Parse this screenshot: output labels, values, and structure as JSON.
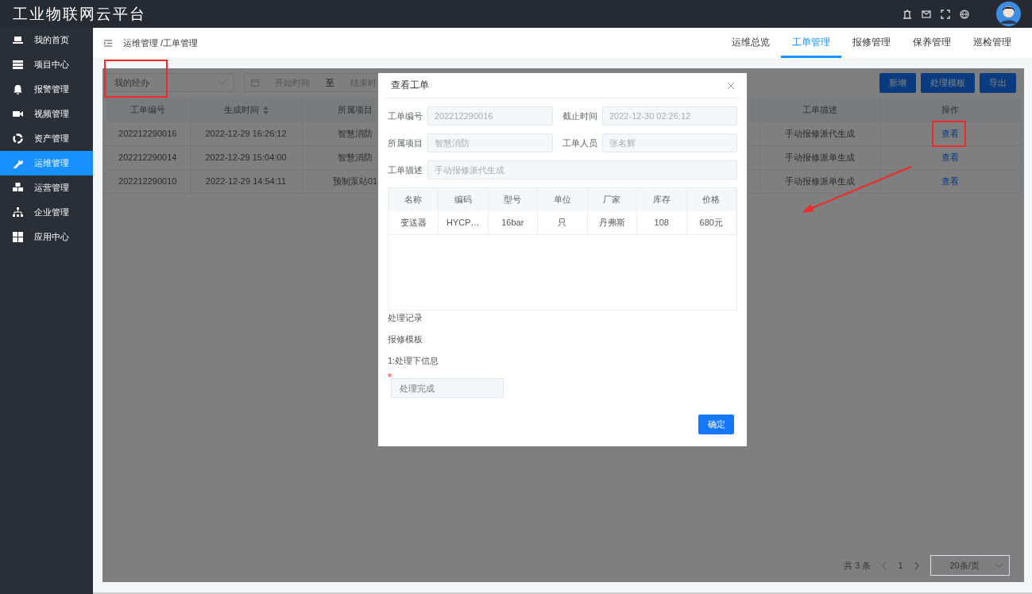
{
  "app": {
    "title": "工业物联网云平台"
  },
  "sidebar": {
    "items": [
      {
        "label": "我的首页",
        "selected": false
      },
      {
        "label": "项目中心",
        "selected": false
      },
      {
        "label": "报警管理",
        "selected": false
      },
      {
        "label": "视频管理",
        "selected": false
      },
      {
        "label": "资产管理",
        "selected": false
      },
      {
        "label": "运维管理",
        "selected": true
      },
      {
        "label": "运营管理",
        "selected": false
      },
      {
        "label": "企业管理",
        "selected": false
      },
      {
        "label": "应用中心",
        "selected": false
      }
    ]
  },
  "breadcrumb": "运维管理 /工单管理",
  "tabs": [
    {
      "label": "运维总览",
      "selected": false
    },
    {
      "label": "工单管理",
      "selected": true
    },
    {
      "label": "报修管理",
      "selected": false
    },
    {
      "label": "保养管理",
      "selected": false
    },
    {
      "label": "巡检管理",
      "selected": false
    }
  ],
  "filters": {
    "scope": {
      "value": "我的经办"
    },
    "date_range": {
      "start_placeholder": "开始时间",
      "separator": "至",
      "end_placeholder": "结束时"
    }
  },
  "actions": [
    "新增",
    "处理模板",
    "导出"
  ],
  "table": {
    "columns": [
      {
        "label": "工单编号",
        "sortable": false
      },
      {
        "label": "生成时间",
        "sortable": true
      },
      {
        "label": "所属项目",
        "sortable": false
      },
      {
        "label": "工单描述",
        "sortable": false
      },
      {
        "label": "操作",
        "sortable": false
      }
    ],
    "rows": [
      {
        "cells": [
          "202212290016",
          "2022-12-29 16:26:12",
          "智慧消防",
          "手动报修派代生成"
        ],
        "action": "查看"
      },
      {
        "cells": [
          "202212290014",
          "2022-12-29 15:04:00",
          "智慧消防",
          "手动报修派单生成"
        ],
        "action": "查看"
      },
      {
        "cells": [
          "202212290010",
          "2022-12-29 14:54:11",
          "预制泵站01",
          "手动报修派单生成"
        ],
        "action": "查看"
      }
    ]
  },
  "pagination": {
    "total": "共 3 条",
    "page": "1",
    "page_size": "20条/页"
  },
  "dialog": {
    "title": "查看工单",
    "fields": [
      {
        "label": "工单编号",
        "value": "202212290016"
      },
      {
        "label": "截止时间",
        "value": "2022-12-30 02:26:12"
      },
      {
        "label": "所属项目",
        "value": "智慧消防"
      },
      {
        "label": "工单人员",
        "value": "张名辉"
      }
    ],
    "description": {
      "label": "工单描述",
      "value": "手动报修派代生成"
    },
    "items_table": {
      "columns": [
        "名称",
        "编码",
        "型号",
        "单位",
        "厂家",
        "库存",
        "价格"
      ],
      "rows": [
        [
          "变送器",
          "HYCP…",
          "16bar",
          "只",
          "丹弗斯",
          "108",
          "680元"
        ]
      ]
    },
    "sections": [
      "处理记录",
      "报修模板",
      "1:处理下信息"
    ],
    "result": {
      "required": true,
      "placeholder": "处理完成"
    },
    "confirm": "确定"
  }
}
